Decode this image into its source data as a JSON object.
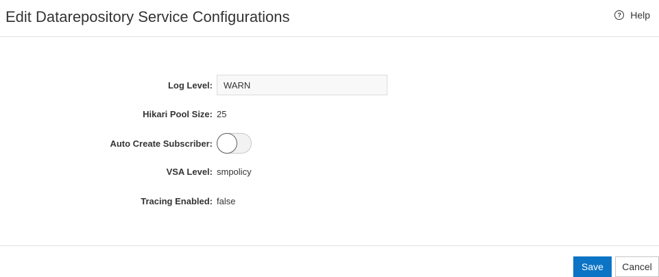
{
  "header": {
    "title": "Edit Datarepository Service Configurations",
    "help_label": "Help",
    "help_icon": "question-circle-icon"
  },
  "form": {
    "log_level": {
      "label": "Log Level:",
      "value": "WARN"
    },
    "hikari_pool_size": {
      "label": "Hikari Pool Size:",
      "value": "25"
    },
    "auto_create_subscriber": {
      "label": "Auto Create Subscriber:",
      "enabled": false
    },
    "vsa_level": {
      "label": "VSA Level:",
      "value": "smpolicy"
    },
    "tracing_enabled": {
      "label": "Tracing Enabled:",
      "value": "false"
    }
  },
  "footer": {
    "save_label": "Save",
    "cancel_label": "Cancel"
  },
  "colors": {
    "primary": "#0b74c4",
    "text": "#333333",
    "divider": "#e3e3e3"
  }
}
